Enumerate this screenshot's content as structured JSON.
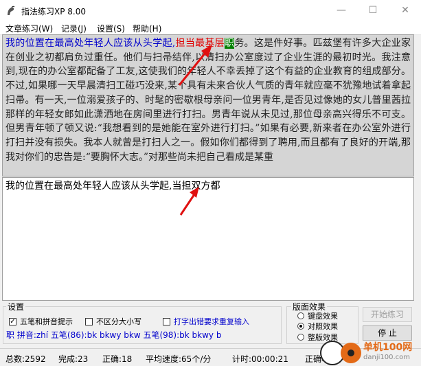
{
  "window": {
    "title": "指法练习XP 8.00",
    "minimize": "—",
    "maximize": "☐",
    "close": "✕"
  },
  "menu": [
    "文章练习(W)",
    "记录(J)",
    "设置(S)",
    "帮助(H)"
  ],
  "source": {
    "typed_correct": "我的位置在最高处年轻人应该从头学起,",
    "typed_wrong": "担当最基层",
    "current_char": "职",
    "remaining": "务。这是件好事。匹兹堡有许多大企业家在创业之初都肩负过重任。他们与扫帚结伴,以清扫办公室度过了企业生涯的最初时光。我注意到,现在的办公室都配备了工友,这使我们的年轻人不幸丢掉了这个有益的企业教育的组成部分。不过,如果哪一天早晨清扫工碰巧没来,某个具有未来合伙人气质的青年就应毫不犹豫地试着拿起扫帚。有一天,一位溺爱孩子的、时髦的密歇根母亲问一位男青年,是否见过像她的女儿普里茜拉那样的年轻女郎如此潇洒地在房间里进行打扫。男青年说从未见过,那位母亲高兴得乐不可支。但男青年顿了顿又说:“我想看到的是她能在室外进行打扫。”如果有必要,新来者在办公室外进行打扫并没有损失。我本人就曾是打扫人之一。假如你们都得到了聘用,而且都有了良好的开端,那我对你们的忠告是:“要胸怀大志。”对那些尚未把自己看成是某重"
  },
  "input": {
    "text": "我的位置在最高处年轻人应该从头学起,当担双方都"
  },
  "settings": {
    "legend": "设置",
    "wubi_pinyin_hint": "五笔和拼音提示",
    "case_insensitive": "不区分大小写",
    "retype_on_error": "打字出错要求重复输入",
    "wubi_pinyin_checked": true,
    "case_insensitive_checked": false,
    "retype_on_error_checked": false,
    "hint_line": "职 拼音:zhí 五笔(86):bk bkwy bkw 五笔(98):bk bkwy b"
  },
  "effects": {
    "legend": "版面效果",
    "options": [
      "键盘效果",
      "对照效果",
      "整版效果"
    ],
    "selected": "对照效果"
  },
  "buttons": {
    "start": "开始练习",
    "stop": "停 止"
  },
  "status": {
    "total": "总数:2592",
    "done": "完成:23",
    "correct": "正确:18",
    "speed": "平均速度:65个/分",
    "timer": "计时:00:00:21",
    "accuracy": "正确率"
  },
  "watermark": {
    "name": "单机100网",
    "url": "danji100.com"
  },
  "colors": {
    "typed_correct": "#0000cc",
    "typed_wrong": "#e00000",
    "current_char_bg": "#008000",
    "source_bg": "#d5d5d5",
    "annotation_arrow": "#e01010"
  }
}
